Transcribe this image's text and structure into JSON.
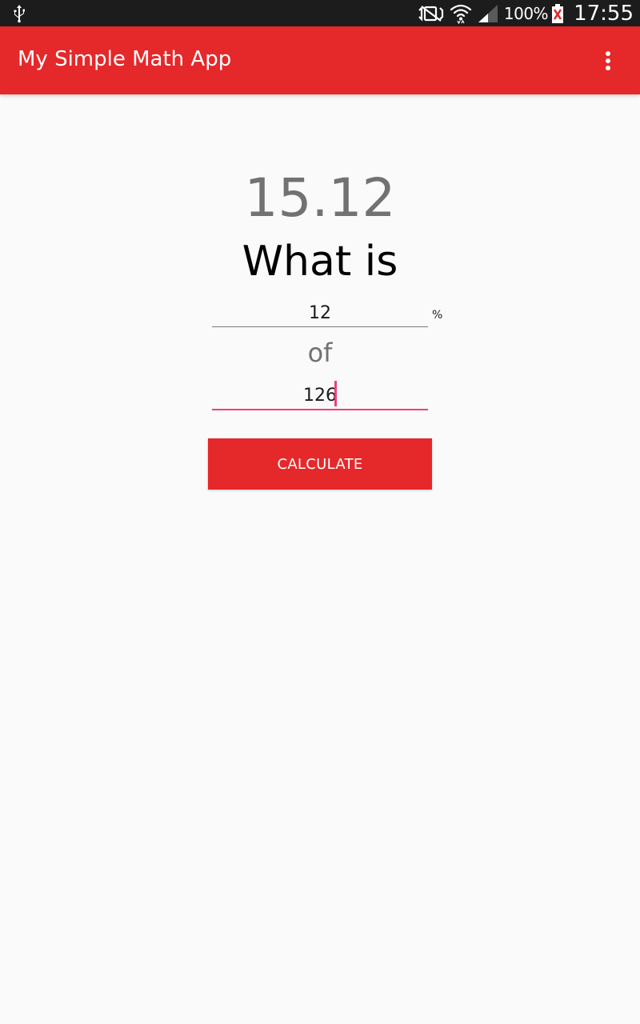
{
  "status_bar": {
    "battery_percent": "100%",
    "time": "17:55",
    "icons": [
      "usb-icon",
      "vibrate-off-icon",
      "wifi-icon",
      "signal-icon",
      "battery-icon"
    ]
  },
  "app_bar": {
    "title": "My Simple Math App",
    "menu_icon": "overflow-menu-icon"
  },
  "main": {
    "result": "15.12",
    "question": "What is",
    "percent_value": "12",
    "percent_sign": "%",
    "of_label": "of",
    "total_value": "126",
    "calculate_label": "CALCULATE"
  },
  "colors": {
    "primary": "#e5282a",
    "accent": "#ec407a",
    "status_bar": "#1c1c1c",
    "background": "#fafafa"
  }
}
